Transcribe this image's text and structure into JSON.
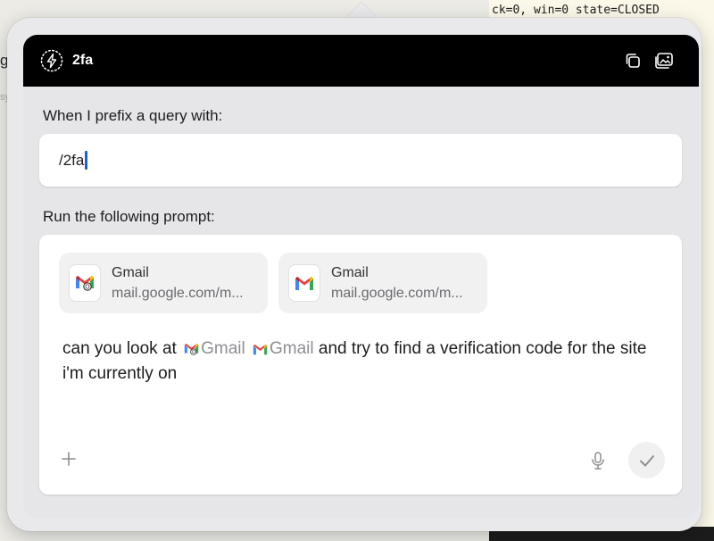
{
  "background": {
    "terminal_text": "ck=0, win=0 state=CLOSED",
    "left_fragment": "g",
    "left_fragment2": "sy"
  },
  "shortcut": {
    "title": "2fa",
    "icon": "bolt-icon",
    "prefix_label": "When I prefix a query with:",
    "prefix_value": "/2fa",
    "prompt_label": "Run the following prompt:"
  },
  "attachments": [
    {
      "title": "Gmail",
      "url": "mail.google.com/m...",
      "icon": "gmail-profile-icon"
    },
    {
      "title": "Gmail",
      "url": "mail.google.com/m...",
      "icon": "gmail-icon"
    }
  ],
  "prompt": {
    "text_before": "can you look at",
    "mention_1": "Gmail",
    "mention_2": "Gmail",
    "text_after": "and try to find a verification code for the site i'm currently on"
  },
  "colors": {
    "title_bar": "#000000",
    "caret": "#1f5de0",
    "gmail_red": "#ea4335",
    "gmail_blue": "#4285f4",
    "gmail_green": "#34a853",
    "gmail_yellow": "#fbbc04"
  }
}
